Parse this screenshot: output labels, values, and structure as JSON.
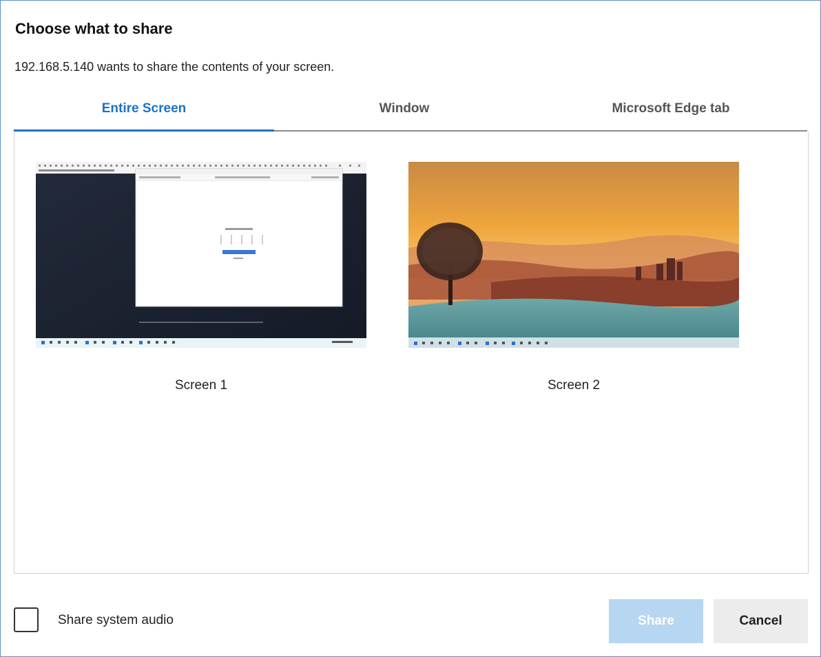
{
  "dialog": {
    "title": "Choose what to share",
    "subtitle": "192.168.5.140 wants to share the contents of your screen."
  },
  "tabs": [
    {
      "label": "Entire Screen",
      "active": true
    },
    {
      "label": "Window",
      "active": false
    },
    {
      "label": "Microsoft Edge tab",
      "active": false
    }
  ],
  "screens": [
    {
      "label": "Screen 1"
    },
    {
      "label": "Screen 2"
    }
  ],
  "footer": {
    "audio_label": "Share system audio",
    "audio_checked": false,
    "share_label": "Share",
    "cancel_label": "Cancel"
  },
  "colors": {
    "accent": "#1a73c7",
    "share_disabled_bg": "#b7d6f2",
    "cancel_bg": "#ececec"
  }
}
